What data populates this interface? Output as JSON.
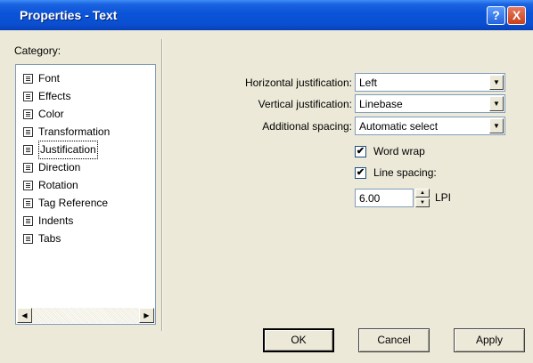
{
  "window": {
    "title": "Properties - Text"
  },
  "titlebar": {
    "help_glyph": "?",
    "close_glyph": "X"
  },
  "category": {
    "label": "Category:",
    "items": [
      {
        "label": "Font",
        "selected": false
      },
      {
        "label": "Effects",
        "selected": false
      },
      {
        "label": "Color",
        "selected": false
      },
      {
        "label": "Transformation",
        "selected": false
      },
      {
        "label": "Justification",
        "selected": true
      },
      {
        "label": "Direction",
        "selected": false
      },
      {
        "label": "Rotation",
        "selected": false
      },
      {
        "label": "Tag Reference",
        "selected": false
      },
      {
        "label": "Indents",
        "selected": false
      },
      {
        "label": "Tabs",
        "selected": false
      }
    ]
  },
  "fields": {
    "horizontal": {
      "label": "Horizontal justification:",
      "value": "Left"
    },
    "vertical": {
      "label": "Vertical justification:",
      "value": "Linebase"
    },
    "spacing": {
      "label": "Additional spacing:",
      "value": "Automatic select"
    }
  },
  "options": {
    "word_wrap": {
      "label": "Word wrap",
      "checked": true
    },
    "line_spacing": {
      "label": "Line spacing:",
      "checked": true
    }
  },
  "line_spacing_value": {
    "value": "6.00",
    "unit": "LPI"
  },
  "buttons": {
    "ok": "OK",
    "cancel": "Cancel",
    "apply": "Apply"
  }
}
